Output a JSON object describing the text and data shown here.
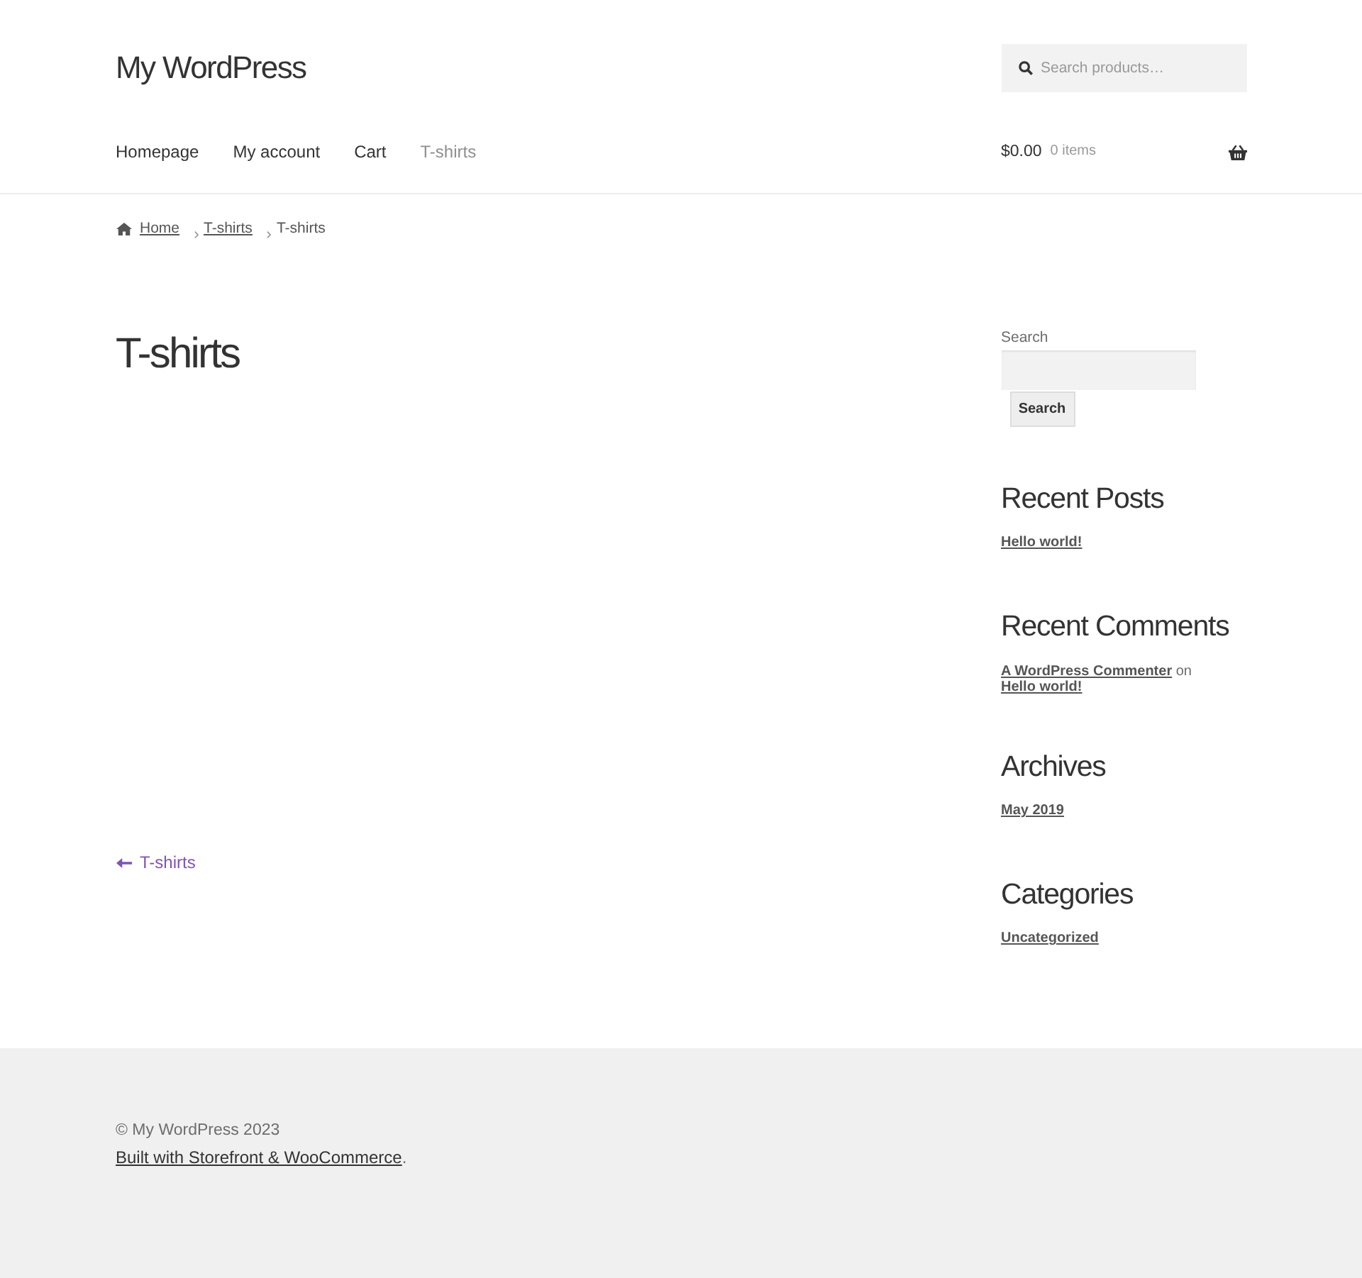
{
  "site": {
    "title": "My WordPress"
  },
  "search": {
    "placeholder": "Search products…"
  },
  "nav": [
    {
      "label": "Homepage",
      "selected": false
    },
    {
      "label": "My account",
      "selected": false
    },
    {
      "label": "Cart",
      "selected": false
    },
    {
      "label": "T-shirts",
      "selected": true
    }
  ],
  "cart": {
    "total": "$0.00",
    "count": "0 items"
  },
  "breadcrumb": [
    {
      "kind": "home",
      "label": "Home",
      "current": false
    },
    {
      "kind": "page",
      "label": "T-shirts",
      "current": false
    },
    {
      "kind": "page",
      "label": "T-shirts",
      "current": true
    }
  ],
  "page": {
    "title": "T-shirts"
  },
  "post_nav": {
    "previous": "T-shirts"
  },
  "sidebar": {
    "search": {
      "label": "Search",
      "button": "Search"
    },
    "widgets": [
      {
        "kind": "links",
        "title": "Recent Posts",
        "items": [
          "Hello world!"
        ]
      },
      {
        "kind": "comments",
        "title": "Recent Comments",
        "items": [
          {
            "author": "A WordPress Commenter",
            "joiner": "on",
            "post": "Hello world!"
          }
        ]
      },
      {
        "kind": "links",
        "title": "Archives",
        "items": [
          "May 2019"
        ]
      },
      {
        "kind": "links",
        "title": "Categories",
        "items": [
          "Uncategorized"
        ]
      }
    ]
  },
  "footer": {
    "copyright": "© My WordPress 2023",
    "credit": "Built with Storefront & WooCommerce",
    "credit_tail": "."
  }
}
